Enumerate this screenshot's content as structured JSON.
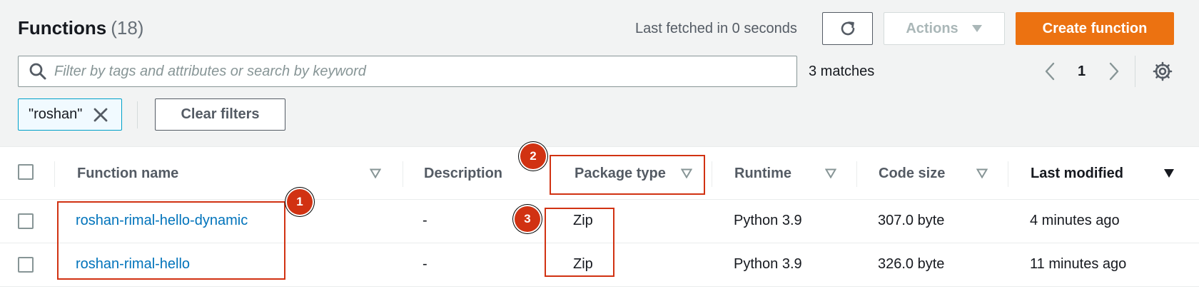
{
  "header": {
    "title": "Functions",
    "count": "(18)",
    "last_fetched": "Last fetched in 0 seconds",
    "refresh_icon": "refresh-icon",
    "actions_label": "Actions",
    "create_label": "Create function"
  },
  "search": {
    "placeholder": "Filter by tags and attributes or search by keyword",
    "value": "",
    "matches": "3 matches"
  },
  "pagination": {
    "current_page": "1"
  },
  "filters": {
    "token": "\"roshan\"",
    "clear_label": "Clear filters"
  },
  "table": {
    "columns": [
      "Function name",
      "Description",
      "Package type",
      "Runtime",
      "Code size",
      "Last modified"
    ],
    "rows": [
      {
        "name": "roshan-rimal-hello-dynamic",
        "description": "-",
        "package_type": "Zip",
        "runtime": "Python 3.9",
        "code_size": "307.0 byte",
        "last_modified": "4 minutes ago"
      },
      {
        "name": "roshan-rimal-hello",
        "description": "-",
        "package_type": "Zip",
        "runtime": "Python 3.9",
        "code_size": "326.0 byte",
        "last_modified": "11 minutes ago"
      }
    ]
  },
  "annotations": [
    "1",
    "2",
    "3"
  ],
  "colors": {
    "primary": "#ec7211",
    "link": "#0073bb",
    "annotation": "#d13212",
    "token_border": "#00a1c9"
  }
}
